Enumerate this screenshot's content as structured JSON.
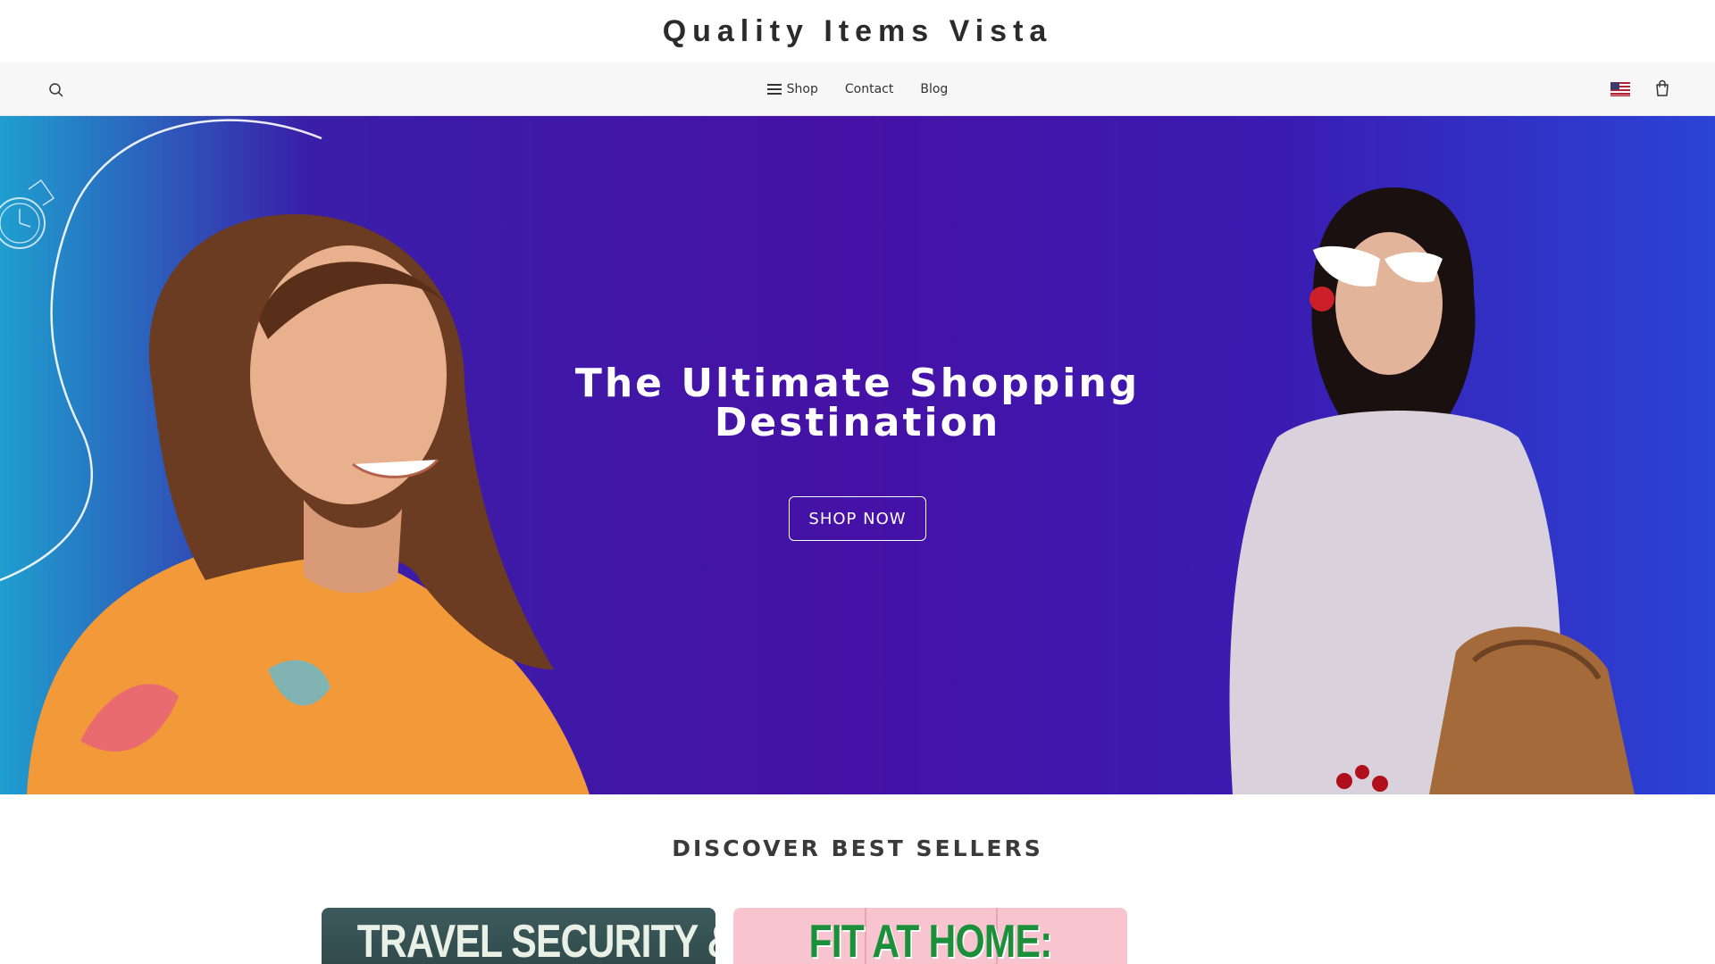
{
  "brand": {
    "title": "Quality Items Vista"
  },
  "nav": {
    "items": [
      {
        "label": "Shop",
        "icon": "hamburger-menu-icon"
      },
      {
        "label": "Contact"
      },
      {
        "label": "Blog"
      }
    ],
    "search_icon": "search-icon",
    "flag_icon": "us-flag-icon",
    "cart_icon": "shopping-bag-icon"
  },
  "hero": {
    "title_line1": "The Ultimate Shopping",
    "title_line2": "Destination",
    "cta_label": "SHOP NOW"
  },
  "best_sellers": {
    "title": "DISCOVER BEST SELLERS",
    "cards": [
      {
        "banner_text": "TRAVEL SECURITY &"
      },
      {
        "banner_text": "FIT AT HOME:"
      }
    ]
  },
  "colors": {
    "hero_gradient": [
      "#1f9fcf",
      "#4611a6",
      "#2a44d6"
    ],
    "text_dark": "#2b2b2b",
    "nav_bg": "#f7f7f7"
  }
}
